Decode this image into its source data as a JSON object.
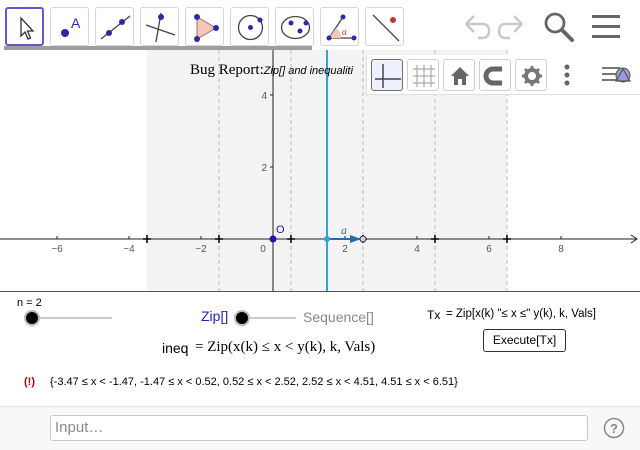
{
  "toolbar": {
    "tools": [
      {
        "name": "move-tool",
        "label": "Move"
      },
      {
        "name": "point-tool",
        "label": "A"
      },
      {
        "name": "line-tool",
        "label": "Line"
      },
      {
        "name": "perpendicular-tool",
        "label": "Perpendicular Line"
      },
      {
        "name": "polygon-tool",
        "label": "Polygon"
      },
      {
        "name": "circle-tool",
        "label": "Circle"
      },
      {
        "name": "ellipse-tool",
        "label": "Ellipse"
      },
      {
        "name": "angle-tool",
        "label": "α"
      },
      {
        "name": "reflect-tool",
        "label": "Reflect"
      }
    ],
    "actions": [
      "undo-icon",
      "redo-icon",
      "search-icon",
      "menu-icon"
    ]
  },
  "graphics": {
    "title": "Bug Report:",
    "subtitle": "Zip[] and inequaliti",
    "origin_label": "O",
    "vector_label": "a",
    "x_ticks": [
      "−6",
      "−4",
      "−2",
      "0",
      "2",
      "4",
      "6",
      "8"
    ],
    "y_ticks": [
      "4",
      "2"
    ]
  },
  "stylebar": [
    "axes-icon",
    "grid-icon",
    "home-icon",
    "magnet-icon",
    "gear-icon",
    "more-icon",
    "view-icon"
  ],
  "panel": {
    "slider_label": "n = 2",
    "zip_label": "Zip[]",
    "sequence_label": "Sequence[]",
    "tx_label": "Tx",
    "tx_formula": "= Zip[x(k) \"≤ x ≤\" y(k), k, Vals]",
    "execute_label": "Execute[Tx]",
    "ineq_label": "ineq",
    "ineq_formula": "= Zip(x(k) ≤ x < y(k), k, Vals)",
    "error_mark": "(!)",
    "result": "{-3.47 ≤ x < -1.47, -1.47 ≤ x < 0.52, 0.52 ≤ x < 2.52, 2.52 ≤ x < 4.51, 4.51 ≤ x < 6.51}"
  },
  "input": {
    "placeholder": "Input…",
    "help": "?"
  }
}
